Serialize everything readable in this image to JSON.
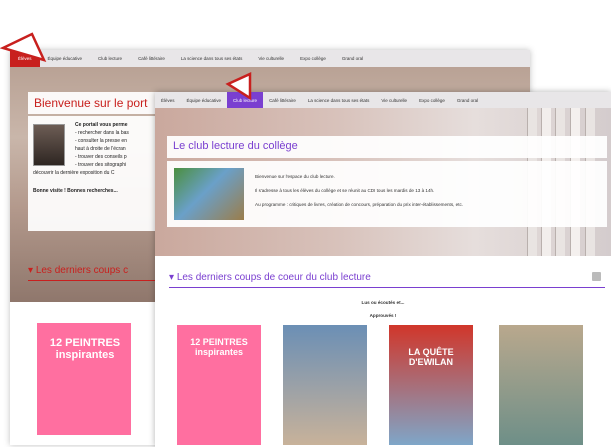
{
  "back": {
    "nav": [
      "Élèves",
      "Équipe éducative",
      "Club lecture",
      "Café littéraire",
      "La science dans tous ses états",
      "Vie culturelle",
      "Expo collège",
      "Grand oral"
    ],
    "welcome": "Bienvenue sur le port",
    "intro_lines": [
      "Ce portail vous perme",
      "- rechercher dans la bas",
      "- consulter la presse en",
      "haut à droite de l'écran",
      "- trouver des conseils p",
      "- trouver des sitographi",
      "découvrir la dernière exposition du C"
    ],
    "intro_bold": "Bonne visite ! Bonnes recherches...",
    "section": "Les derniers coups c",
    "book_title": "12 PEINTRES inspirantes",
    "colors": {
      "accent": "#c8201e"
    }
  },
  "front": {
    "nav": [
      "Élèves",
      "Équipe éducative",
      "Club lecture",
      "Café littéraire",
      "La science dans tous ses états",
      "Vie culturelle",
      "Expo collège",
      "Grand oral"
    ],
    "title": "Le club lecture du collège",
    "paragraphs": [
      "Bienvenue sur l'espace du club lecture.",
      "Il s'adresse à tous les élèves du collège et se réunit au CDI tous les mardis de 13 à 14h.",
      "Au programme : critiques de livres, création de concours, préparation du prix inter-établissements, etc."
    ],
    "section": "Les derniers coups de coeur du club lecture",
    "caption1": "Lus ou écoutés et...",
    "caption2": "Approuvés !",
    "books": [
      {
        "title": "12 PEINTRES inspirantes",
        "color": "#ff6fa0"
      },
      {
        "title": "",
        "color": "#6b8fb5"
      },
      {
        "title": "LA QUÊTE D'EWILAN",
        "color": "#d1362a"
      },
      {
        "title": "",
        "color": "#b9a88d"
      }
    ],
    "colors": {
      "accent": "#7a3fd0"
    }
  }
}
